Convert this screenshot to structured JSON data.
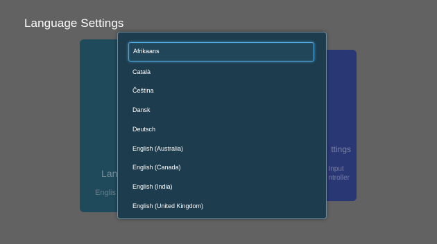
{
  "page": {
    "title": "Language Settings"
  },
  "background_cards": {
    "left": {
      "title": "Lan",
      "subtitle": "Englis"
    },
    "right": {
      "title": "ttings",
      "subtitle_line1": "Input",
      "subtitle_line2": "ntroller"
    }
  },
  "dialog": {
    "selected_index": 0,
    "languages": [
      "Afrikaans",
      "Català",
      "Čeština",
      "Dansk",
      "Deutsch",
      "English (Australia)",
      "English (Canada)",
      "English (India)",
      "English (United Kingdom)"
    ]
  },
  "colors": {
    "background": "#626262",
    "dialog": "#1d3c4d",
    "focus_border": "#4fa6d9",
    "left_card": "#1f4a5c",
    "right_card": "#2a3775"
  }
}
